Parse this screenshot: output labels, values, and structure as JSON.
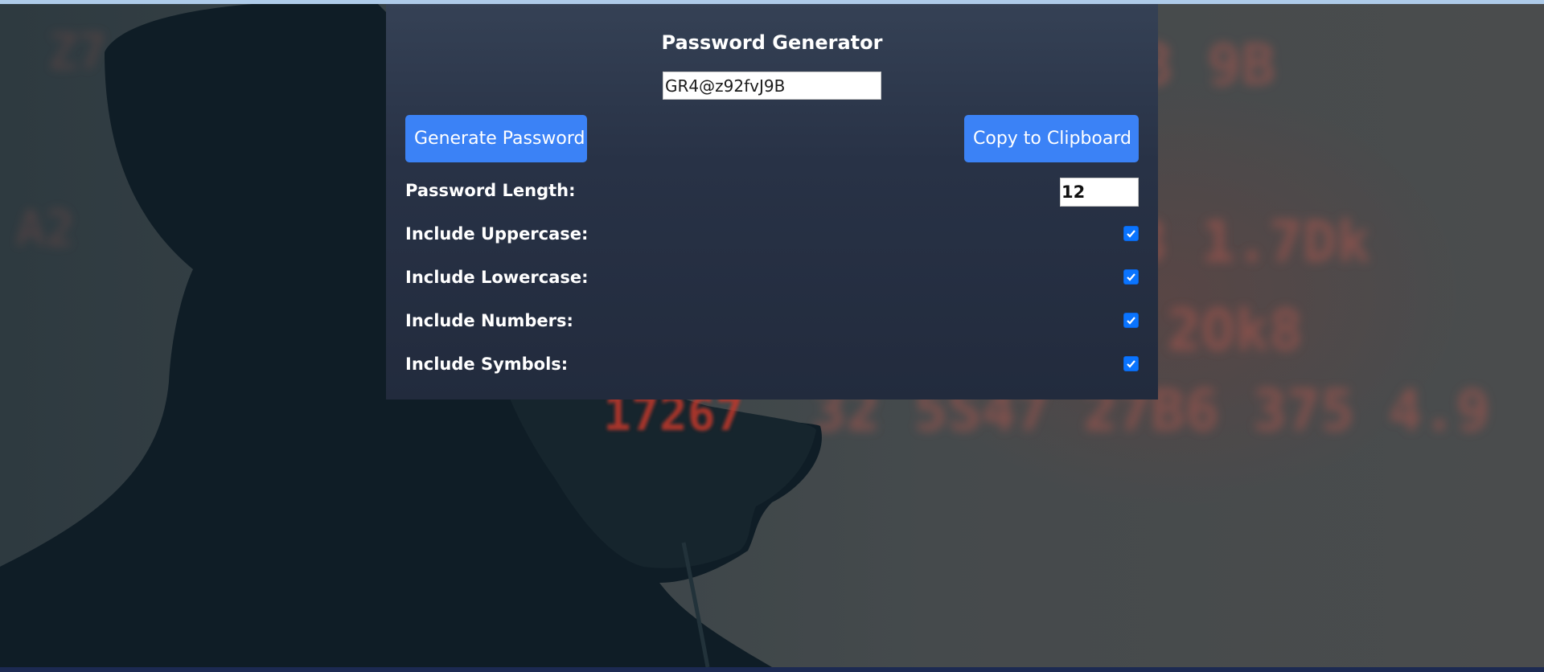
{
  "app": {
    "title": "Password Generator"
  },
  "password": {
    "value": "GR4@z92fvJ9B"
  },
  "buttons": {
    "generate_label": "Generate Password",
    "copy_label": "Copy to Clipboard"
  },
  "options": {
    "length_label": "Password Length:",
    "length_value": "12",
    "uppercase_label": "Include Uppercase:",
    "uppercase_checked": true,
    "lowercase_label": "Include Lowercase:",
    "lowercase_checked": true,
    "numbers_label": "Include Numbers:",
    "numbers_checked": true,
    "symbols_label": "Include Symbols:",
    "symbols_checked": true
  },
  "colors": {
    "accent": "#3b82f6",
    "checkbox": "#0a74ff",
    "panel_top": "#354155",
    "panel_bottom": "#222b3d"
  },
  "icons": {
    "checkbox_mark": "checkmark-icon"
  }
}
